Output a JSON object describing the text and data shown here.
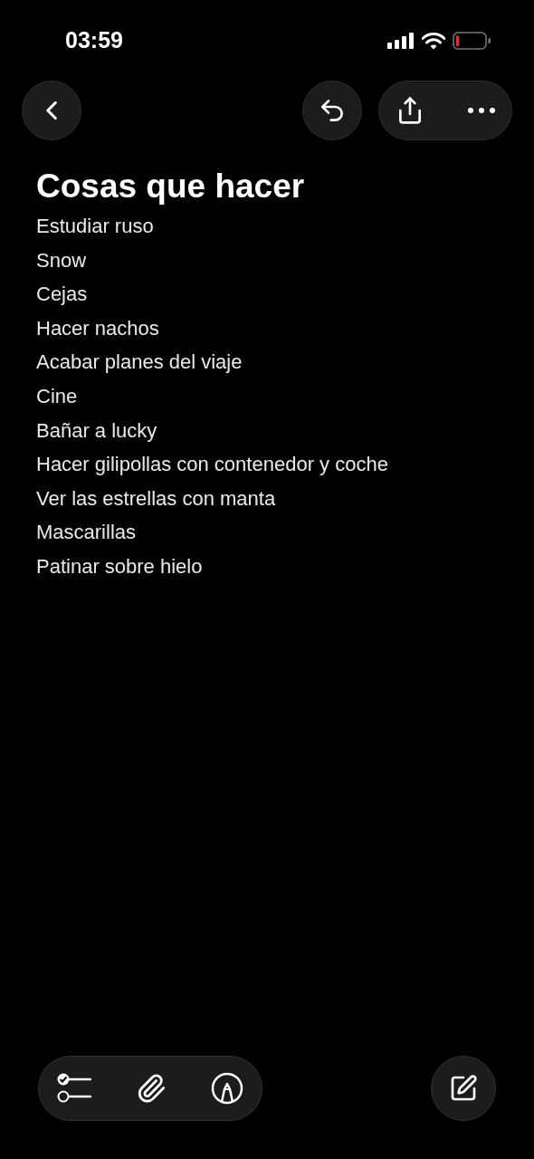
{
  "status_bar": {
    "time": "03:59"
  },
  "note": {
    "title": "Cosas que hacer",
    "lines": [
      "Estudiar ruso",
      "Snow",
      "Cejas",
      "Hacer nachos",
      "Acabar planes del viaje",
      "Cine",
      "Bañar a lucky",
      "Hacer gilipollas con contenedor y coche",
      "Ver las estrellas con manta",
      "Mascarillas",
      "Patinar sobre hielo"
    ]
  }
}
